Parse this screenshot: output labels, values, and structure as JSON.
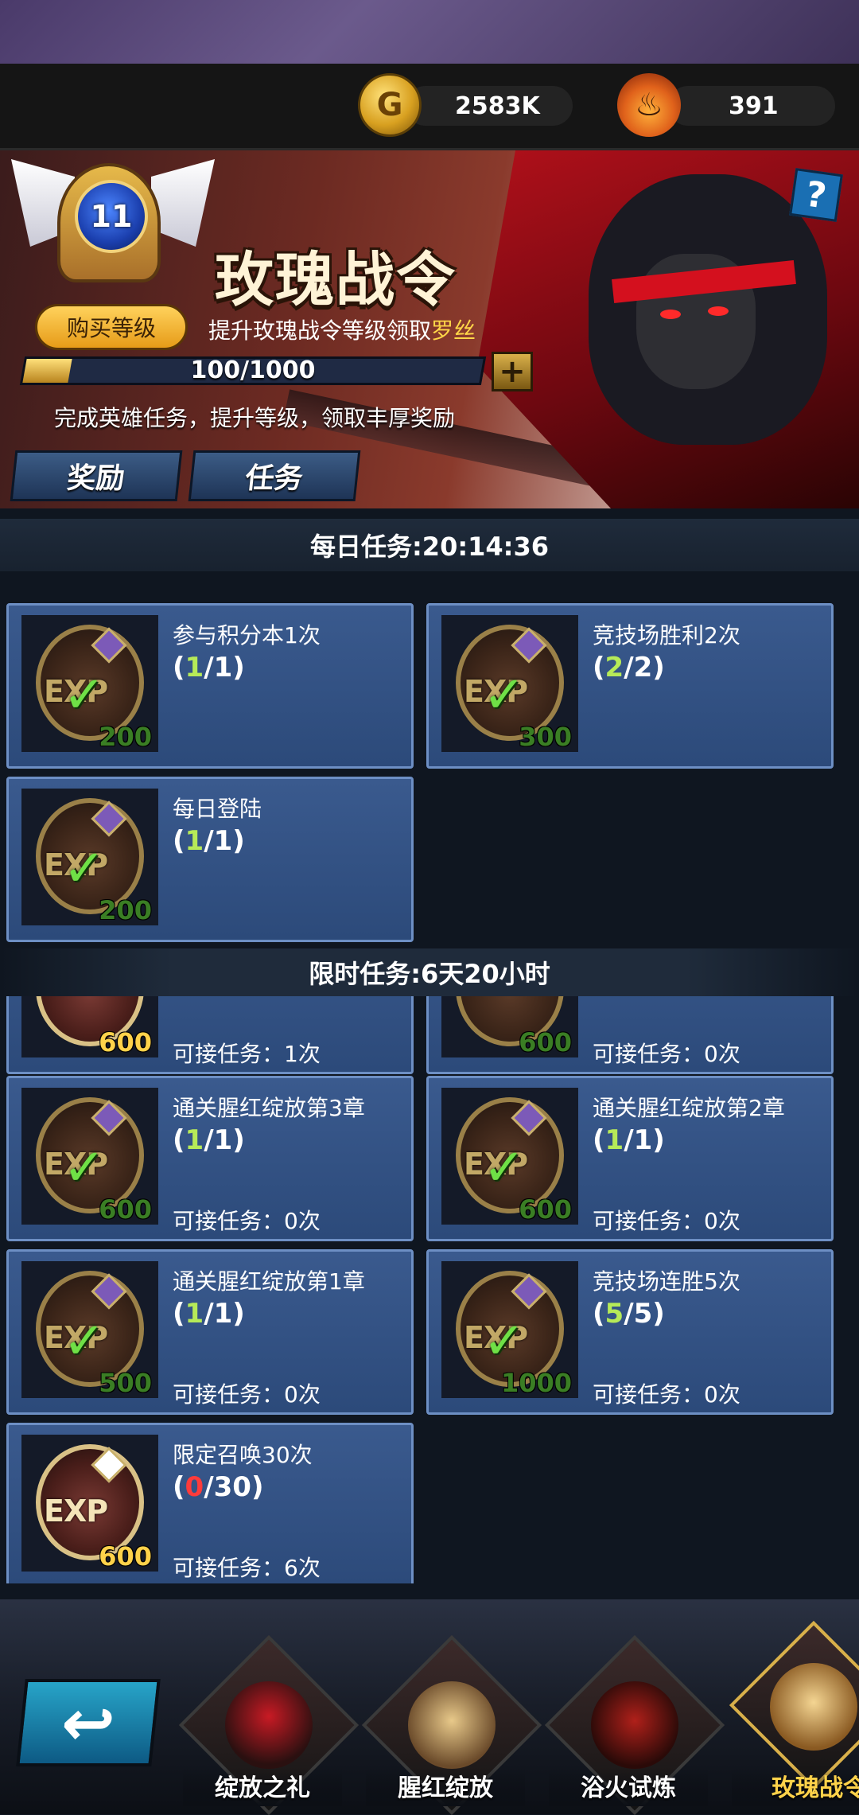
{
  "currency": {
    "gold": "2583K",
    "gold_icon_glyph": "G",
    "energy": "391",
    "energy_icon_glyph": "♨"
  },
  "banner": {
    "level": "11",
    "title": "玫瑰战令",
    "buy_level_label": "购买等级",
    "hint_prefix": "提升玫瑰战令等级领取",
    "hint_highlight": "罗丝",
    "progress_text": "100/1000",
    "progress_fraction": 0.1,
    "plus_glyph": "+",
    "description": "完成英雄任务，提升等级，领取丰厚奖励",
    "help_glyph": "?",
    "tabs": [
      "奖励",
      "任务"
    ]
  },
  "daily": {
    "header": "每日任务:20:14:36",
    "tasks": [
      {
        "name": "参与积分本1次",
        "prog_open": "(",
        "done": "1",
        "prog_close": "/1)",
        "reward": "200"
      },
      {
        "name": "竞技场胜利2次",
        "prog_open": "(",
        "done": "2",
        "prog_close": "/2)",
        "reward": "300"
      },
      {
        "name": "每日登陆",
        "prog_open": "(",
        "done": "1",
        "prog_close": "/1)",
        "reward": "200"
      }
    ]
  },
  "limited": {
    "header": "限时任务:6天20小时",
    "partial": [
      {
        "reward": "600",
        "accept": "可接任务：1次"
      },
      {
        "reward": "600",
        "accept": "可接任务：0次"
      }
    ],
    "tasks": [
      {
        "name": "通关腥红绽放第3章",
        "prog_open": "(",
        "done": "1",
        "prog_close": "/1)",
        "reward": "600",
        "accept": "可接任务：0次"
      },
      {
        "name": "通关腥红绽放第2章",
        "prog_open": "(",
        "done": "1",
        "prog_close": "/1)",
        "reward": "600",
        "accept": "可接任务：0次"
      },
      {
        "name": "通关腥红绽放第1章",
        "prog_open": "(",
        "done": "1",
        "prog_close": "/1)",
        "reward": "500",
        "accept": "可接任务：0次"
      },
      {
        "name": "竞技场连胜5次",
        "prog_open": "(",
        "done": "5",
        "prog_close": "/5)",
        "reward": "1000",
        "accept": "可接任务：0次"
      },
      {
        "name": "限定召唤30次",
        "prog_open": "(",
        "done": "0",
        "prog_close": "/30)",
        "reward": "600",
        "accept": "可接任务：6次"
      }
    ]
  },
  "exp_label": "EXP",
  "check_glyph": "✓",
  "nav": {
    "back_glyph": "↩",
    "items": [
      "绽放之礼",
      "腥红绽放",
      "浴火试炼",
      "玫瑰战令"
    ]
  }
}
